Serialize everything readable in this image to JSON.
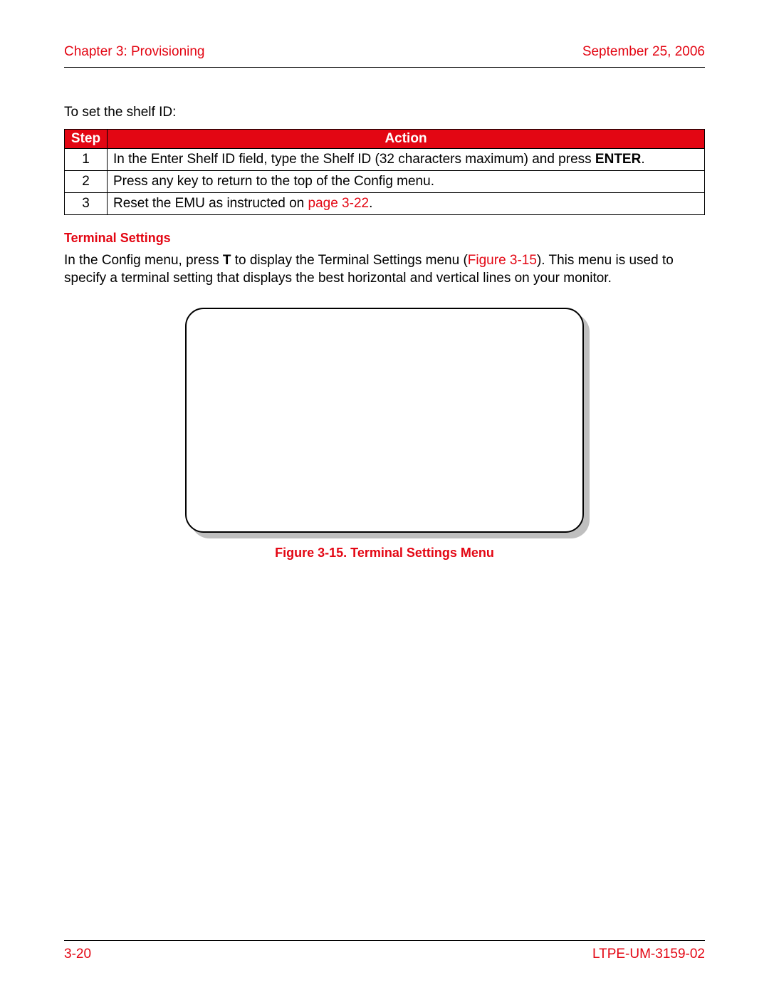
{
  "header": {
    "chapter": "Chapter 3: Provisioning",
    "date": "September 25, 2006"
  },
  "intro": "To set the shelf ID:",
  "table": {
    "headers": {
      "step": "Step",
      "action": "Action"
    },
    "rows": [
      {
        "num": "1",
        "action_pre": "In the Enter Shelf ID field, type the Shelf ID (32 characters maximum) and press ",
        "action_bold": "ENTER",
        "action_post": "."
      },
      {
        "num": "2",
        "action_pre": "Press any key to return to the top of the Config menu.",
        "action_bold": "",
        "action_post": ""
      },
      {
        "num": "3",
        "action_pre": "Reset the EMU as instructed on ",
        "action_link": "page 3-22",
        "action_post": "."
      }
    ]
  },
  "section": {
    "heading": "Terminal Settings",
    "para_pre": "In the Config menu, press ",
    "para_bold": "T",
    "para_mid": " to display the Terminal Settings menu (",
    "para_link": "Figure 3-15",
    "para_post": "). This menu is used to specify a terminal setting that displays the best horizontal and vertical lines on your monitor."
  },
  "figure": {
    "caption": "Figure 3-15. Terminal Settings Menu"
  },
  "footer": {
    "page": "3-20",
    "docid": "LTPE-UM-3159-02"
  }
}
